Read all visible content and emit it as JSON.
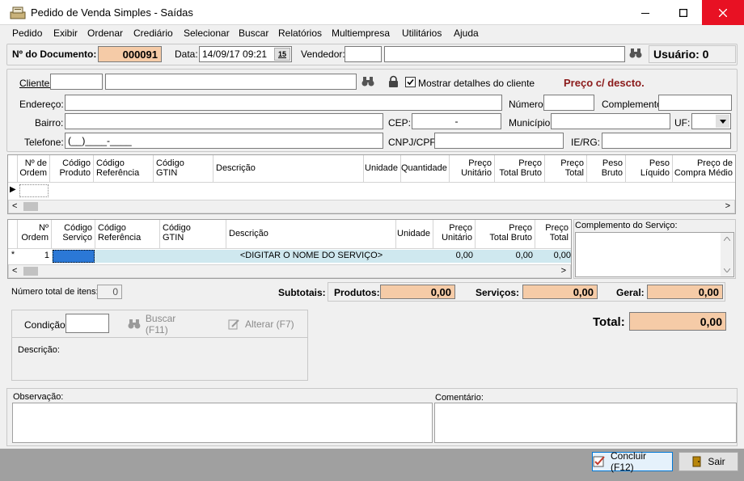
{
  "window": {
    "title": "Pedido de Venda Simples - Saídas",
    "minimize": "—",
    "maximize": "□",
    "close": "✕"
  },
  "menu": [
    "Pedido",
    "Exibir",
    "Ordenar",
    "Crediário",
    "Selecionar",
    "Buscar",
    "Relatórios",
    "Multiempresa",
    "Utilitários",
    "Ajuda"
  ],
  "header": {
    "doc_label": "Nº do Documento:",
    "doc_value": "000091",
    "date_label": "Data:",
    "date_value": "14/09/17 09:21",
    "calendar_glyph": "15",
    "vendedor_label": "Vendedor:",
    "usuario_text": "Usuário: 0"
  },
  "client": {
    "cliente_label": "Cliente:",
    "show_details_label": "Mostrar detalhes do cliente",
    "price_label": "Preço c/ descto.",
    "endereco_label": "Endereço:",
    "numero_label": "Número:",
    "complemento_label": "Complemento:",
    "bairro_label": "Bairro:",
    "cep_label": "CEP:",
    "cep_value": "-",
    "municipio_label": "Município:",
    "uf_label": "UF:",
    "telefone_label": "Telefone:",
    "telefone_value": "(__)____-____",
    "cnpj_label": "CNPJ/CPF:",
    "ie_label": "IE/RG:"
  },
  "products_grid": {
    "columns": [
      [
        "Nº de",
        "Ordem"
      ],
      [
        "Código",
        "Produto"
      ],
      [
        "Código",
        "Referência"
      ],
      [
        "Código",
        "GTIN"
      ],
      [
        "Descrição",
        ""
      ],
      [
        "Unidade",
        ""
      ],
      [
        "Quantidade",
        ""
      ],
      [
        "Preço",
        "Unitário"
      ],
      [
        "Preço",
        "Total Bruto"
      ],
      [
        "Preço",
        "Total"
      ],
      [
        "Peso",
        "Bruto"
      ],
      [
        "Peso",
        "Líquido"
      ],
      [
        "Preço de",
        "Compra Médio"
      ]
    ],
    "row_marker": "▶"
  },
  "services_grid": {
    "columns": [
      [
        "Nº",
        "Ordem"
      ],
      [
        "Código",
        "Serviço"
      ],
      [
        "Código",
        "Referência"
      ],
      [
        "Código",
        "GTIN"
      ],
      [
        "Descrição",
        ""
      ],
      [
        "Unidade",
        ""
      ],
      [
        "Preço",
        "Unitário"
      ],
      [
        "Preço",
        "Total Bruto"
      ],
      [
        "Preço",
        "Total"
      ]
    ],
    "row": {
      "marker": "*",
      "ordem": "1",
      "descricao": "<DIGITAR O NOME DO SERVIÇO>",
      "unitario": "0,00",
      "total_bruto": "0,00",
      "total": "0,00"
    },
    "complemento_label": "Complemento do Serviço:"
  },
  "totals": {
    "num_items_label": "Número total de itens:",
    "num_items_value": "0",
    "subtotais_label": "Subtotais:",
    "produtos_label": "Produtos:",
    "produtos_value": "0,00",
    "servicos_label": "Serviços:",
    "servicos_value": "0,00",
    "geral_label": "Geral:",
    "geral_value": "0,00",
    "total_label": "Total:",
    "total_value": "0,00"
  },
  "condition": {
    "condicao_label": "Condição:",
    "buscar_label": "Buscar (F11)",
    "alterar_label": "Alterar (F7)",
    "descricao_label": "Descrição:"
  },
  "notes": {
    "observacao_label": "Observação:",
    "comentario_label": "Comentário:"
  },
  "footer": {
    "concluir_label": "Concluir (F12)",
    "sair_label": "Sair"
  },
  "colors": {
    "peach": "#f5cba7",
    "price_red": "#8b1a1a",
    "selected_blue": "#2b78d6",
    "row_cyan": "#cfe8ef"
  }
}
